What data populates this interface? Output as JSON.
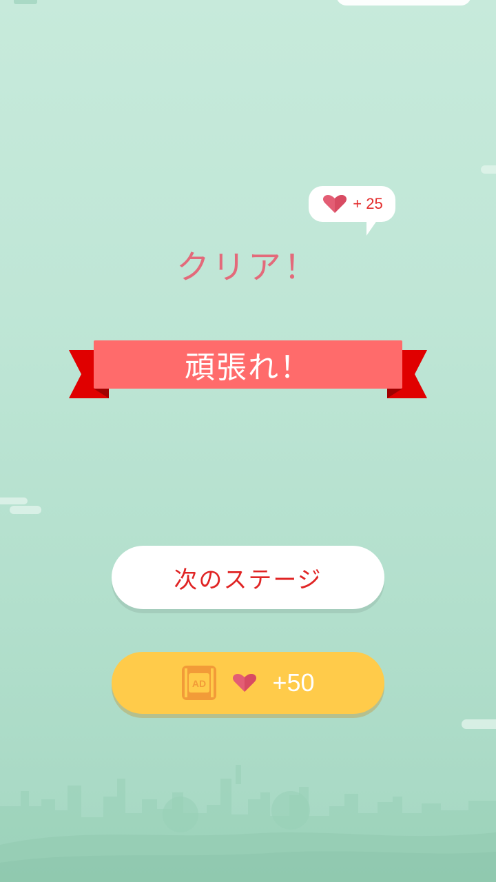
{
  "reward_bubble": {
    "text": "+ 25",
    "icon": "heart-icon"
  },
  "result": {
    "title": "クリア！",
    "banner": "頑張れ！"
  },
  "buttons": {
    "next_label": "次のステージ",
    "ad_label": "AD",
    "ad_reward": "+50"
  },
  "colors": {
    "background": "#c7eadb",
    "title": "#e36a7a",
    "banner": "#ff6b6b",
    "banner_tail": "#e00000",
    "next_text": "#e02424",
    "ad_button": "#ffcb4a",
    "heart": "#e35d74",
    "ad_icon": "#f29b38"
  }
}
